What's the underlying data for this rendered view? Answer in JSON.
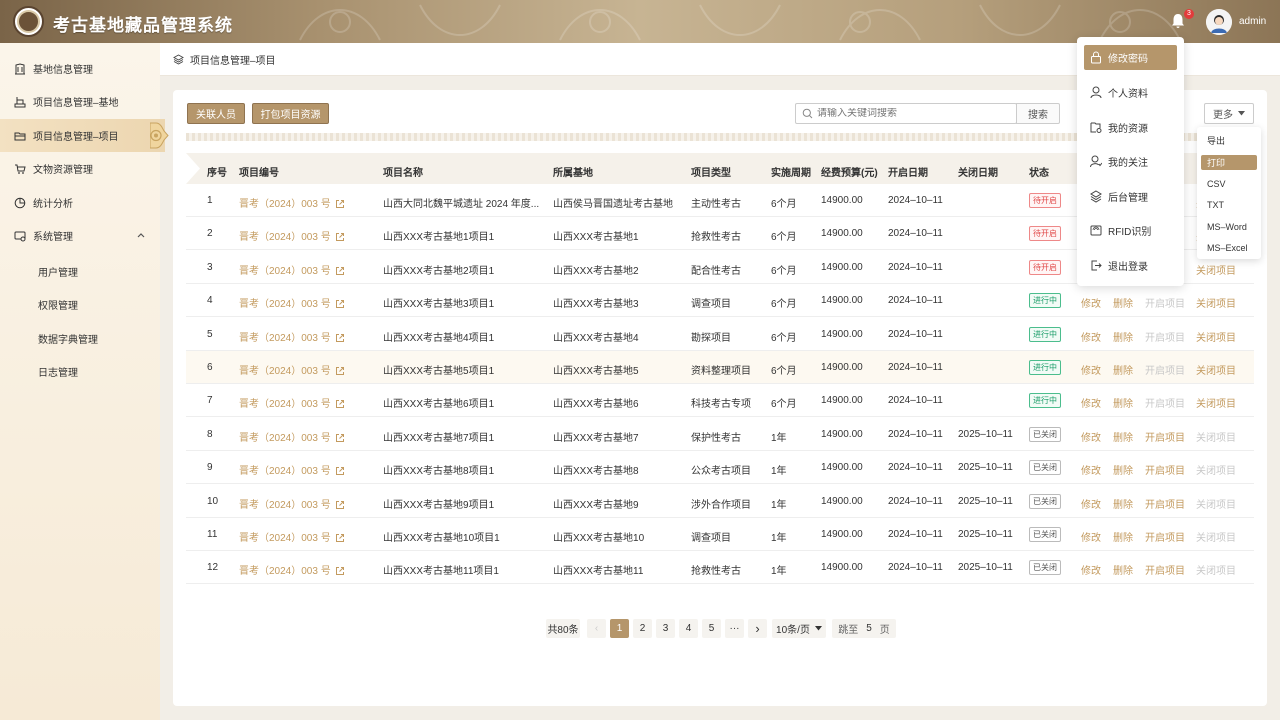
{
  "app": {
    "title": "考古基地藏品管理系统",
    "notification_count": "3",
    "user_name": "admin"
  },
  "sidebar": {
    "items": [
      {
        "label": "基地信息管理",
        "icon": "museum-icon"
      },
      {
        "label": "项目信息管理–基地",
        "icon": "pillar-icon"
      },
      {
        "label": "项目信息管理–项目",
        "icon": "folder-icon",
        "active": true
      },
      {
        "label": "文物资源管理",
        "icon": "cart-icon"
      },
      {
        "label": "统计分析",
        "icon": "pie-chart-icon"
      },
      {
        "label": "系统管理",
        "icon": "settings-panel-icon",
        "expanded": true
      }
    ],
    "sub_items": [
      "用户管理",
      "权限管理",
      "数据字典管理",
      "日志管理"
    ]
  },
  "breadcrumb": {
    "text": "项目信息管理–项目"
  },
  "toolbar": {
    "btn_related": "关联人员",
    "btn_pack": "打包项目资源",
    "search_placeholder": "请输入关键词搜索",
    "search_btn": "搜索",
    "more_btn": "更多"
  },
  "table": {
    "headers": [
      "序号",
      "项目编号",
      "项目名称",
      "所属基地",
      "项目类型",
      "实施周期",
      "经费预算(元)",
      "开启日期",
      "关闭日期",
      "状态"
    ],
    "rows": [
      {
        "no": "1",
        "code": "晋考（2024）003 号",
        "name": "山西大同北魏平城遗址 2024 年度...",
        "base": "山西侯马晋国遗址考古基地",
        "type": "主动性考古",
        "period": "6个月",
        "budget": "14900.00",
        "start": "2024–10–11",
        "end": "",
        "status": "待开启",
        "st": "red"
      },
      {
        "no": "2",
        "code": "晋考（2024）003 号",
        "name": "山西XXX考古基地1项目1",
        "base": "山西XXX考古基地1",
        "type": "抢救性考古",
        "period": "6个月",
        "budget": "14900.00",
        "start": "2024–10–11",
        "end": "",
        "status": "待开启",
        "st": "red"
      },
      {
        "no": "3",
        "code": "晋考（2024）003 号",
        "name": "山西XXX考古基地2项目1",
        "base": "山西XXX考古基地2",
        "type": "配合性考古",
        "period": "6个月",
        "budget": "14900.00",
        "start": "2024–10–11",
        "end": "",
        "status": "待开启",
        "st": "red"
      },
      {
        "no": "4",
        "code": "晋考（2024）003 号",
        "name": "山西XXX考古基地3项目1",
        "base": "山西XXX考古基地3",
        "type": "调查项目",
        "period": "6个月",
        "budget": "14900.00",
        "start": "2024–10–11",
        "end": "",
        "status": "进行中",
        "st": "green"
      },
      {
        "no": "5",
        "code": "晋考（2024）003 号",
        "name": "山西XXX考古基地4项目1",
        "base": "山西XXX考古基地4",
        "type": "勘探项目",
        "period": "6个月",
        "budget": "14900.00",
        "start": "2024–10–11",
        "end": "",
        "status": "进行中",
        "st": "green"
      },
      {
        "no": "6",
        "code": "晋考（2024）003 号",
        "name": "山西XXX考古基地5项目1",
        "base": "山西XXX考古基地5",
        "type": "资料整理项目",
        "period": "6个月",
        "budget": "14900.00",
        "start": "2024–10–11",
        "end": "",
        "status": "进行中",
        "st": "green"
      },
      {
        "no": "7",
        "code": "晋考（2024）003 号",
        "name": "山西XXX考古基地6项目1",
        "base": "山西XXX考古基地6",
        "type": "科技考古专项",
        "period": "6个月",
        "budget": "14900.00",
        "start": "2024–10–11",
        "end": "",
        "status": "进行中",
        "st": "green"
      },
      {
        "no": "8",
        "code": "晋考（2024）003 号",
        "name": "山西XXX考古基地7项目1",
        "base": "山西XXX考古基地7",
        "type": "保护性考古",
        "period": "1年",
        "budget": "14900.00",
        "start": "2024–10–11",
        "end": "2025–10–11",
        "status": "已关闭",
        "st": "gray"
      },
      {
        "no": "9",
        "code": "晋考（2024）003 号",
        "name": "山西XXX考古基地8项目1",
        "base": "山西XXX考古基地8",
        "type": "公众考古项目",
        "period": "1年",
        "budget": "14900.00",
        "start": "2024–10–11",
        "end": "2025–10–11",
        "status": "已关闭",
        "st": "gray"
      },
      {
        "no": "10",
        "code": "晋考（2024）003 号",
        "name": "山西XXX考古基地9项目1",
        "base": "山西XXX考古基地9",
        "type": "涉外合作项目",
        "period": "1年",
        "budget": "14900.00",
        "start": "2024–10–11",
        "end": "2025–10–11",
        "status": "已关闭",
        "st": "gray"
      },
      {
        "no": "11",
        "code": "晋考（2024）003 号",
        "name": "山西XXX考古基地10项目1",
        "base": "山西XXX考古基地10",
        "type": "调查项目",
        "period": "1年",
        "budget": "14900.00",
        "start": "2024–10–11",
        "end": "2025–10–11",
        "status": "已关闭",
        "st": "gray"
      },
      {
        "no": "12",
        "code": "晋考（2024）003 号",
        "name": "山西XXX考古基地11项目1",
        "base": "山西XXX考古基地11",
        "type": "抢救性考古",
        "period": "1年",
        "budget": "14900.00",
        "start": "2024–10–11",
        "end": "2025–10–11",
        "status": "已关闭",
        "st": "gray"
      }
    ],
    "ops": {
      "edit": "修改",
      "delete": "删除",
      "open": "开启项目",
      "close": "关闭项目"
    }
  },
  "pagination": {
    "total": "共80条",
    "prev": "‹",
    "pages": [
      "1",
      "2",
      "3",
      "4",
      "5"
    ],
    "current": "1",
    "ellipsis": "···",
    "next": "›",
    "page_size": "10条/页",
    "goto_label": "跳至",
    "goto_value": "5",
    "goto_suffix": "页"
  },
  "user_menu": {
    "items": [
      {
        "label": "修改密码",
        "icon": "lock-icon",
        "selected": true
      },
      {
        "label": "个人资料",
        "icon": "person-icon"
      },
      {
        "label": "我的资源",
        "icon": "resource-folder-icon"
      },
      {
        "label": "我的关注",
        "icon": "follow-person-icon"
      },
      {
        "label": "后台管理",
        "icon": "layers-icon"
      },
      {
        "label": "RFID识别",
        "icon": "rfid-icon"
      },
      {
        "label": "退出登录",
        "icon": "logout-icon"
      }
    ]
  },
  "more_menu": {
    "items": [
      "导出",
      "打印",
      "CSV",
      "TXT",
      "MS–Word",
      "MS–Excel"
    ],
    "selected": "打印"
  },
  "colors": {
    "accent": "#b5966b",
    "link": "#c39a5e",
    "header": "#a8916f",
    "danger": "#e04848",
    "success": "#1a9c68"
  }
}
